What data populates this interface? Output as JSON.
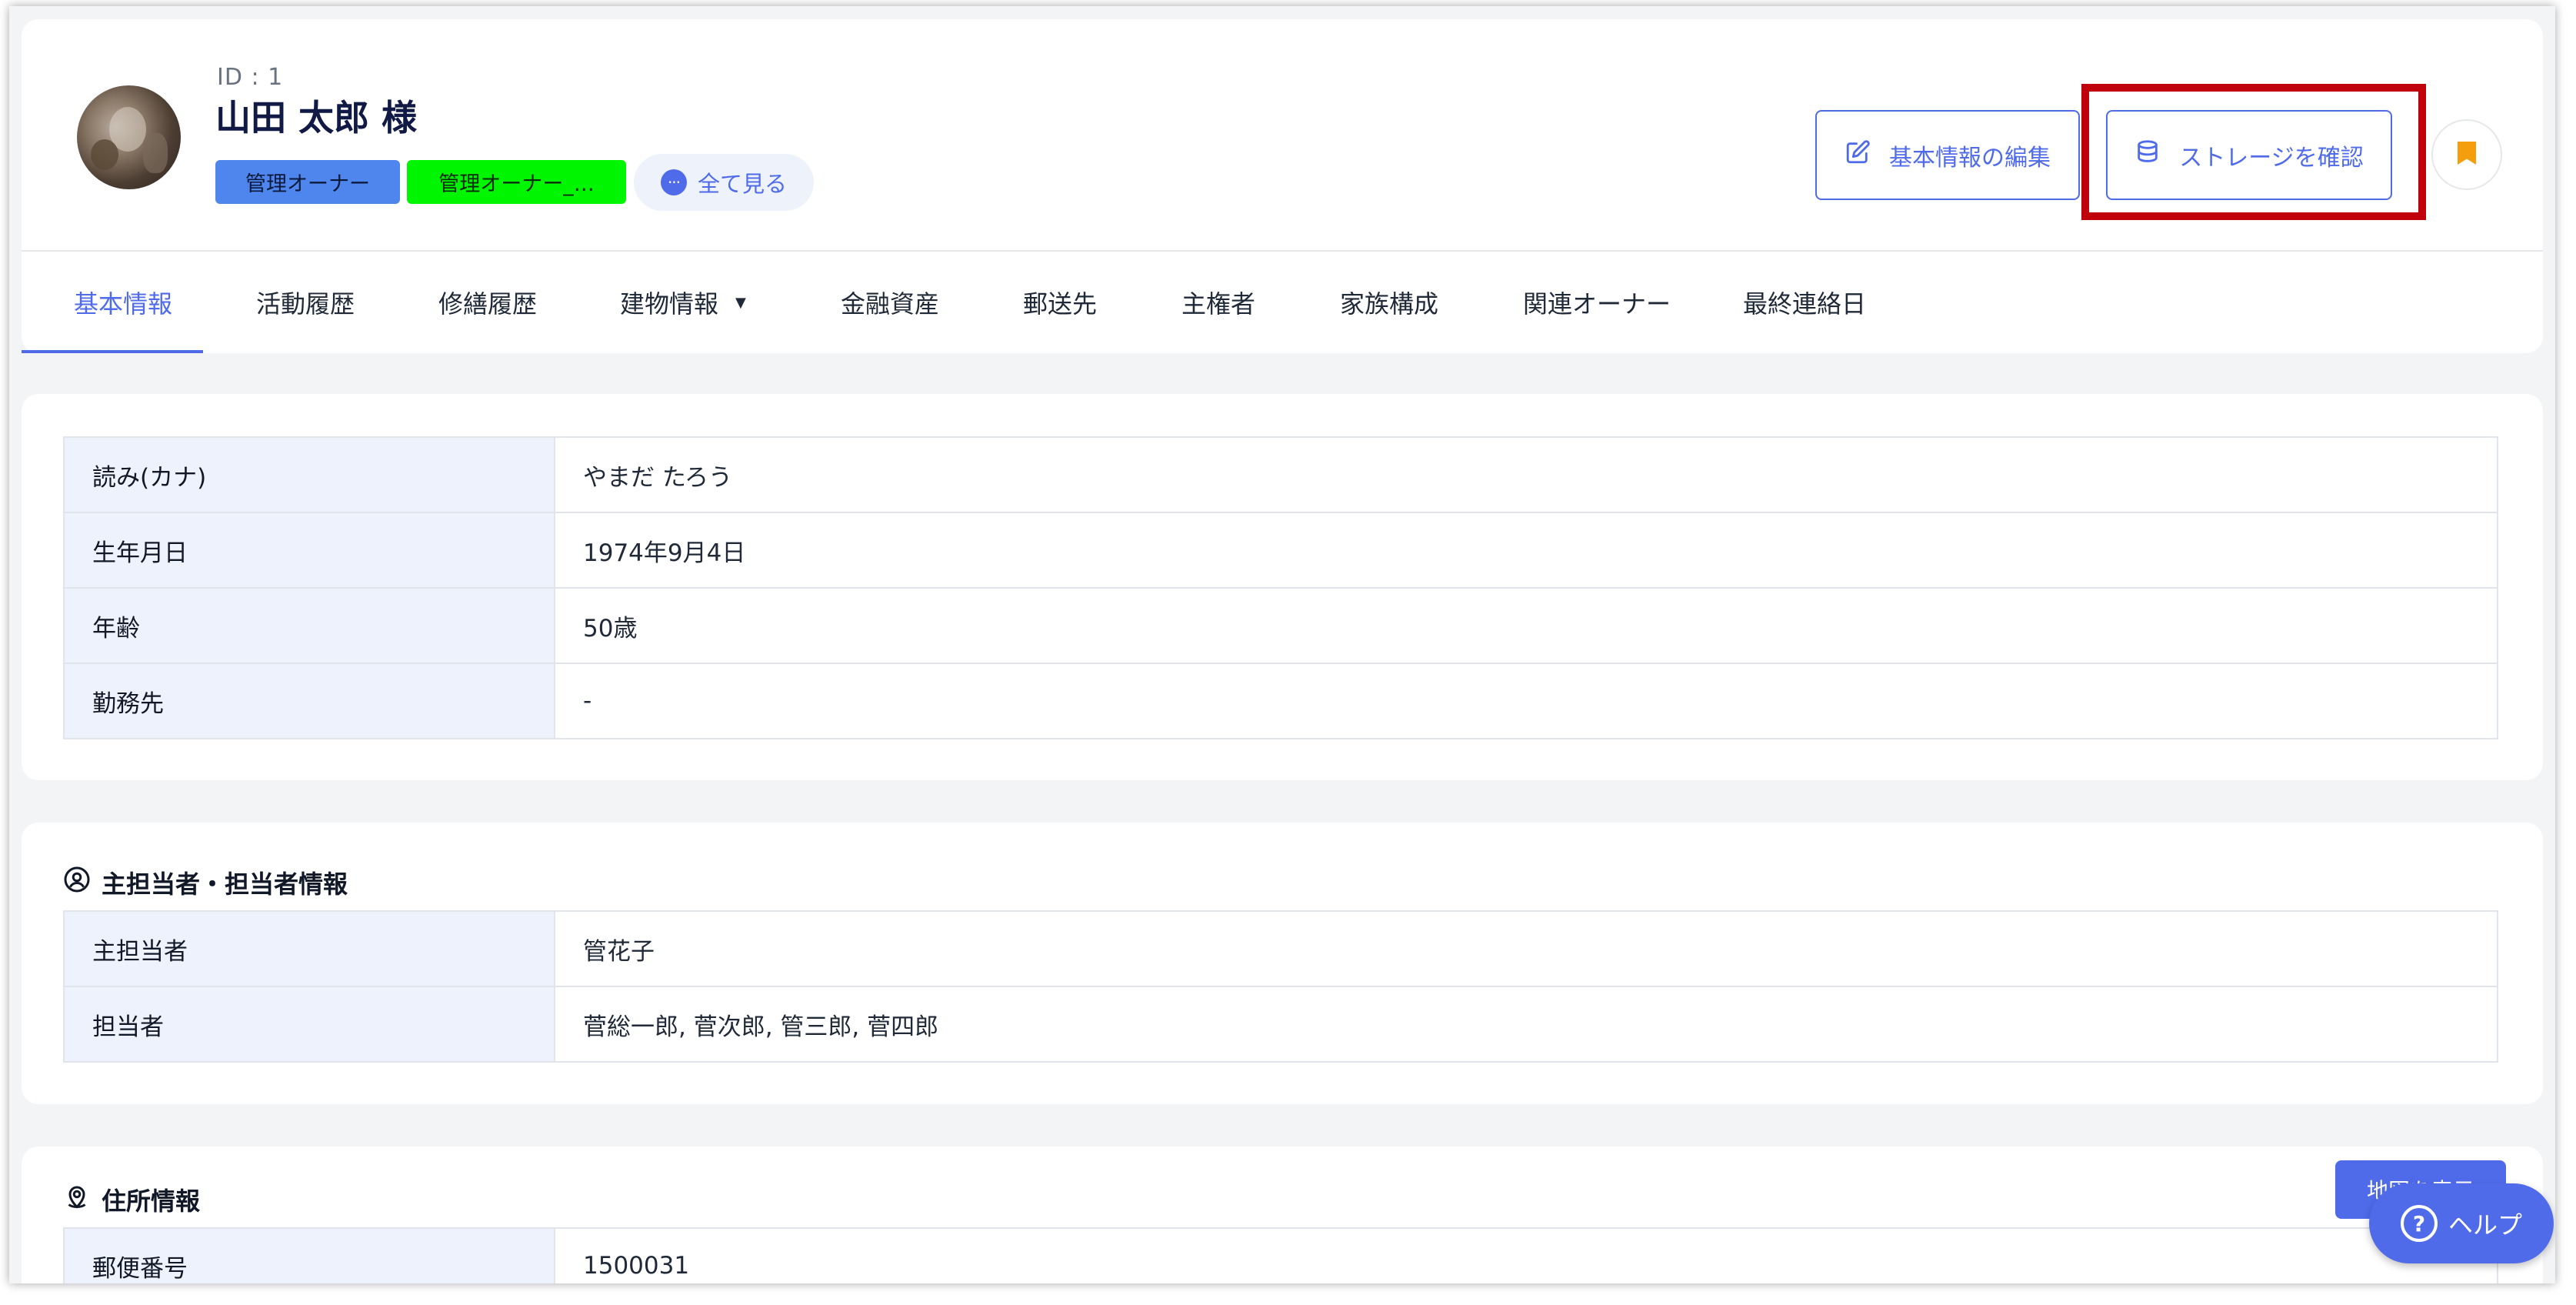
{
  "header": {
    "id_label": "ID : 1",
    "name": "山田 太郎 様",
    "badges": [
      "管理オーナー",
      "管理オーナー_…"
    ],
    "see_all": "全て見る",
    "edit_button": "基本情報の編集",
    "storage_button": "ストレージを確認"
  },
  "tabs": [
    {
      "label": "基本情報"
    },
    {
      "label": "活動履歴"
    },
    {
      "label": "修繕履歴"
    },
    {
      "label": "建物情報"
    },
    {
      "label": "金融資産"
    },
    {
      "label": "郵送先"
    },
    {
      "label": "主権者"
    },
    {
      "label": "家族構成"
    },
    {
      "label": "関連オーナー"
    },
    {
      "label": "最終連絡日"
    }
  ],
  "basic_info": [
    {
      "label": "読み(カナ)",
      "value": "やまだ たろう"
    },
    {
      "label": "生年月日",
      "value": "1974年9月4日"
    },
    {
      "label": "年齢",
      "value": "50歳"
    },
    {
      "label": "勤務先",
      "value": "-"
    }
  ],
  "staff": {
    "title": "主担当者・担当者情報",
    "rows": [
      {
        "label": "主担当者",
        "value": "管花子"
      },
      {
        "label": "担当者",
        "value": "菅総一郎, 菅次郎, 管三郎, 菅四郎"
      }
    ]
  },
  "address": {
    "title": "住所情報",
    "map_button": "地図を表示",
    "rows": [
      {
        "label": "郵便番号",
        "value": "1500031"
      }
    ]
  },
  "help_button": "ヘルプ",
  "colors": {
    "accent": "#4f6bea",
    "badge_blue": "#4f86ee",
    "badge_green": "#00f500",
    "highlight": "#c0000b",
    "bookmark": "#f59e0b"
  }
}
